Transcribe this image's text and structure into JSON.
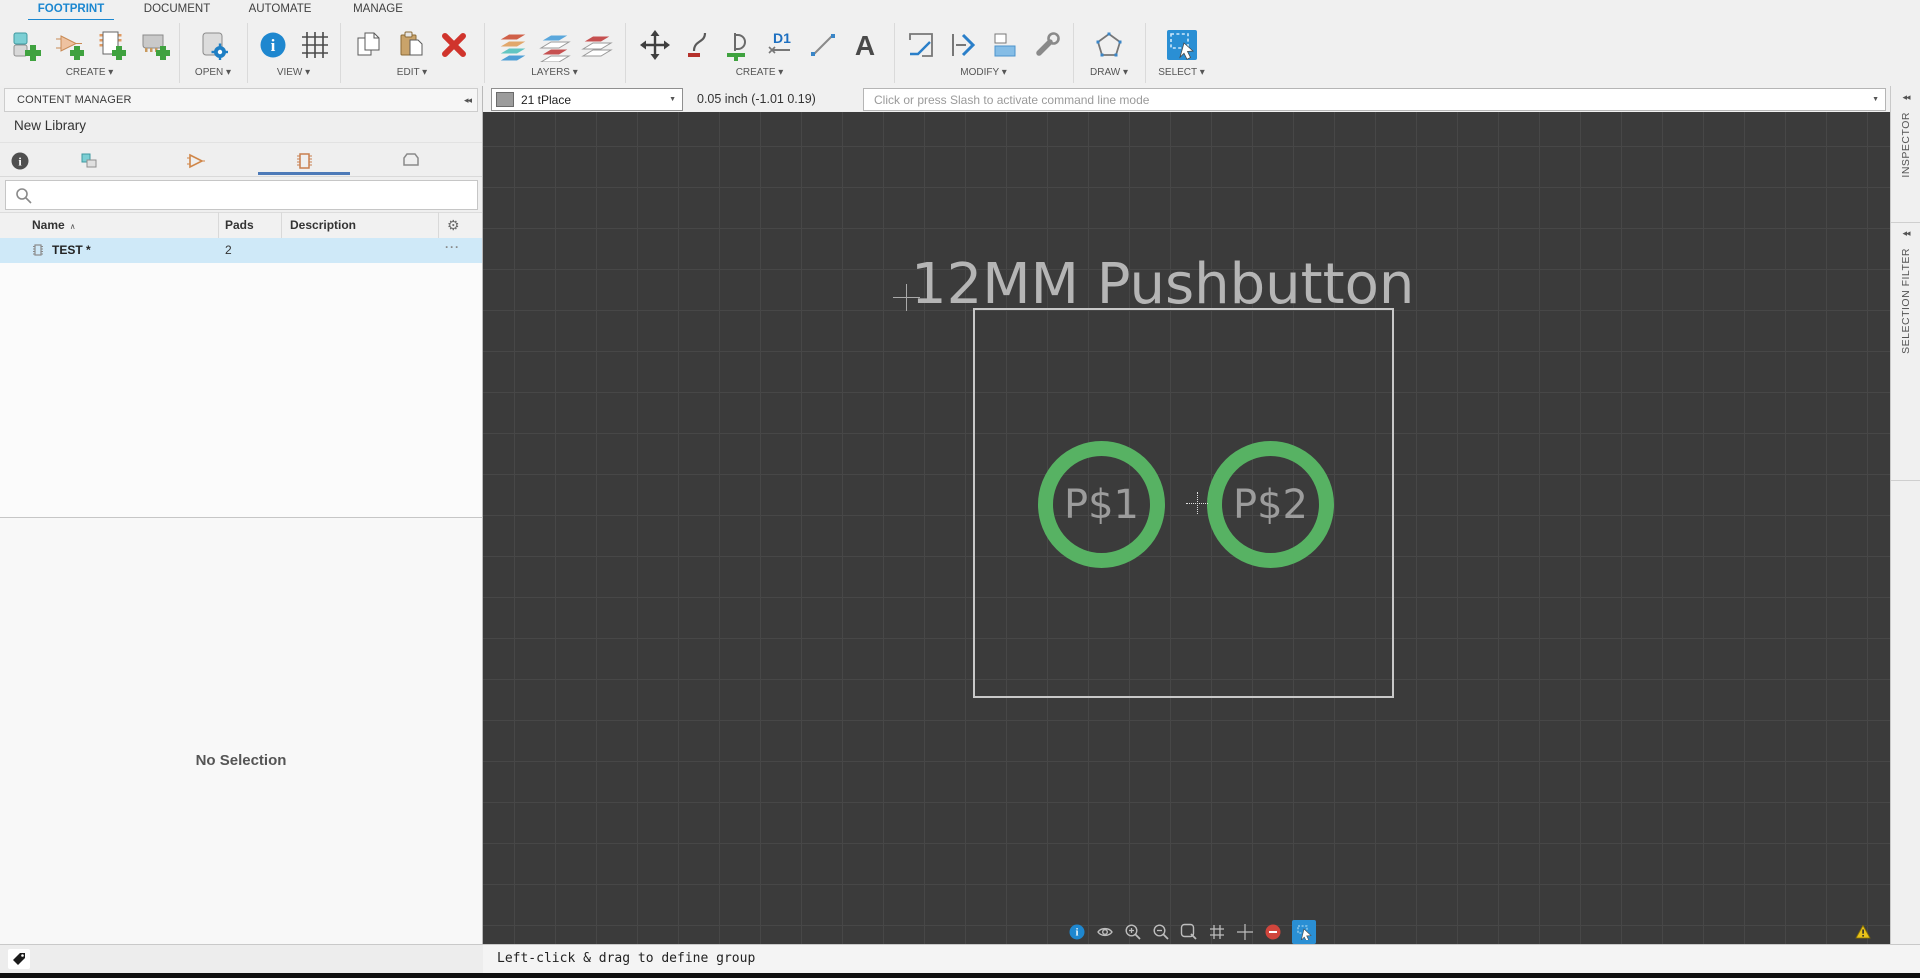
{
  "app_tabs": [
    {
      "label": "FOOTPRINT",
      "active": true
    },
    {
      "label": "DOCUMENT",
      "active": false
    },
    {
      "label": "AUTOMATE",
      "active": false
    },
    {
      "label": "MANAGE",
      "active": false
    }
  ],
  "toolbar_groups": [
    {
      "label": "CREATE ▾",
      "icons": [
        "new-device-icon",
        "new-symbol-icon",
        "new-footprint-icon",
        "new-3d-model-icon"
      ]
    },
    {
      "label": "OPEN ▾",
      "icons": [
        "open-library-icon"
      ]
    },
    {
      "label": "VIEW ▾",
      "icons": [
        "information-icon",
        "grid-icon"
      ]
    },
    {
      "label": "EDIT ▾",
      "icons": [
        "copy-icon",
        "paste-icon",
        "delete-icon"
      ]
    },
    {
      "label": "LAYERS ▾",
      "icons": [
        "layer-colors-icon",
        "layer-visibility-icon",
        "layer-stack-icon"
      ]
    },
    {
      "label": "CREATE ▾",
      "icons": [
        "move-icon",
        "route-icon",
        "pad-icon",
        "name-icon",
        "line-icon",
        "text-icon"
      ]
    },
    {
      "label": "MODIFY ▾",
      "icons": [
        "miter-icon",
        "direction-icon",
        "align-icon",
        "wrench-icon"
      ]
    },
    {
      "label": "DRAW ▾",
      "icons": [
        "polygon-icon"
      ]
    },
    {
      "label": "SELECT ▾",
      "icons": [
        "box-select-icon"
      ]
    }
  ],
  "content_manager": {
    "title": "CONTENT MANAGER",
    "library_name": "New Library",
    "tab_icons": [
      "info-tab-icon",
      "device-tab-icon",
      "symbol-tab-icon",
      "footprint-tab-icon",
      "package3d-tab-icon"
    ],
    "active_tab": "footprint-tab-icon",
    "search_value": "",
    "table": {
      "columns": [
        "Name",
        "Pads",
        "Description"
      ],
      "rows": [
        {
          "name": "TEST *",
          "pads": "2",
          "description": "",
          "selected": true
        }
      ]
    },
    "preview_placeholder": "No Selection"
  },
  "layer_bar": {
    "layer_selected": "21 tPlace",
    "coordinates": "0.05 inch (-1.01 0.19)",
    "command_placeholder": "Click or press Slash to activate command line mode"
  },
  "canvas": {
    "background_color": "#3b3b3b",
    "grid_color": "#474747",
    "silk_text": "12MM Pushbutton",
    "outline_color": "#c8c8c8",
    "pad_ring_color": "#57b263",
    "pad_label_color": "#9c9c9c",
    "pads": [
      {
        "label": "P$1"
      },
      {
        "label": "P$2"
      }
    ]
  },
  "canvas_toolbar": {
    "icons": [
      "information-icon",
      "eye-icon",
      "zoom-in-icon",
      "zoom-out-icon",
      "zoom-fit-icon",
      "grid-toggle-icon",
      "origin-icon",
      "remove-icon",
      "box-select-icon"
    ],
    "active_icon": "box-select-icon"
  },
  "status_bar": {
    "message": "Left-click & drag to define group"
  },
  "right_rail": [
    {
      "label": "INSPECTOR"
    },
    {
      "label": "SELECTION FILTER"
    }
  ],
  "glyphs": {
    "collapse": "◂◂",
    "dropdown": "▼",
    "sort_asc": "∧",
    "gear": "⚙",
    "row_menu": "···"
  }
}
